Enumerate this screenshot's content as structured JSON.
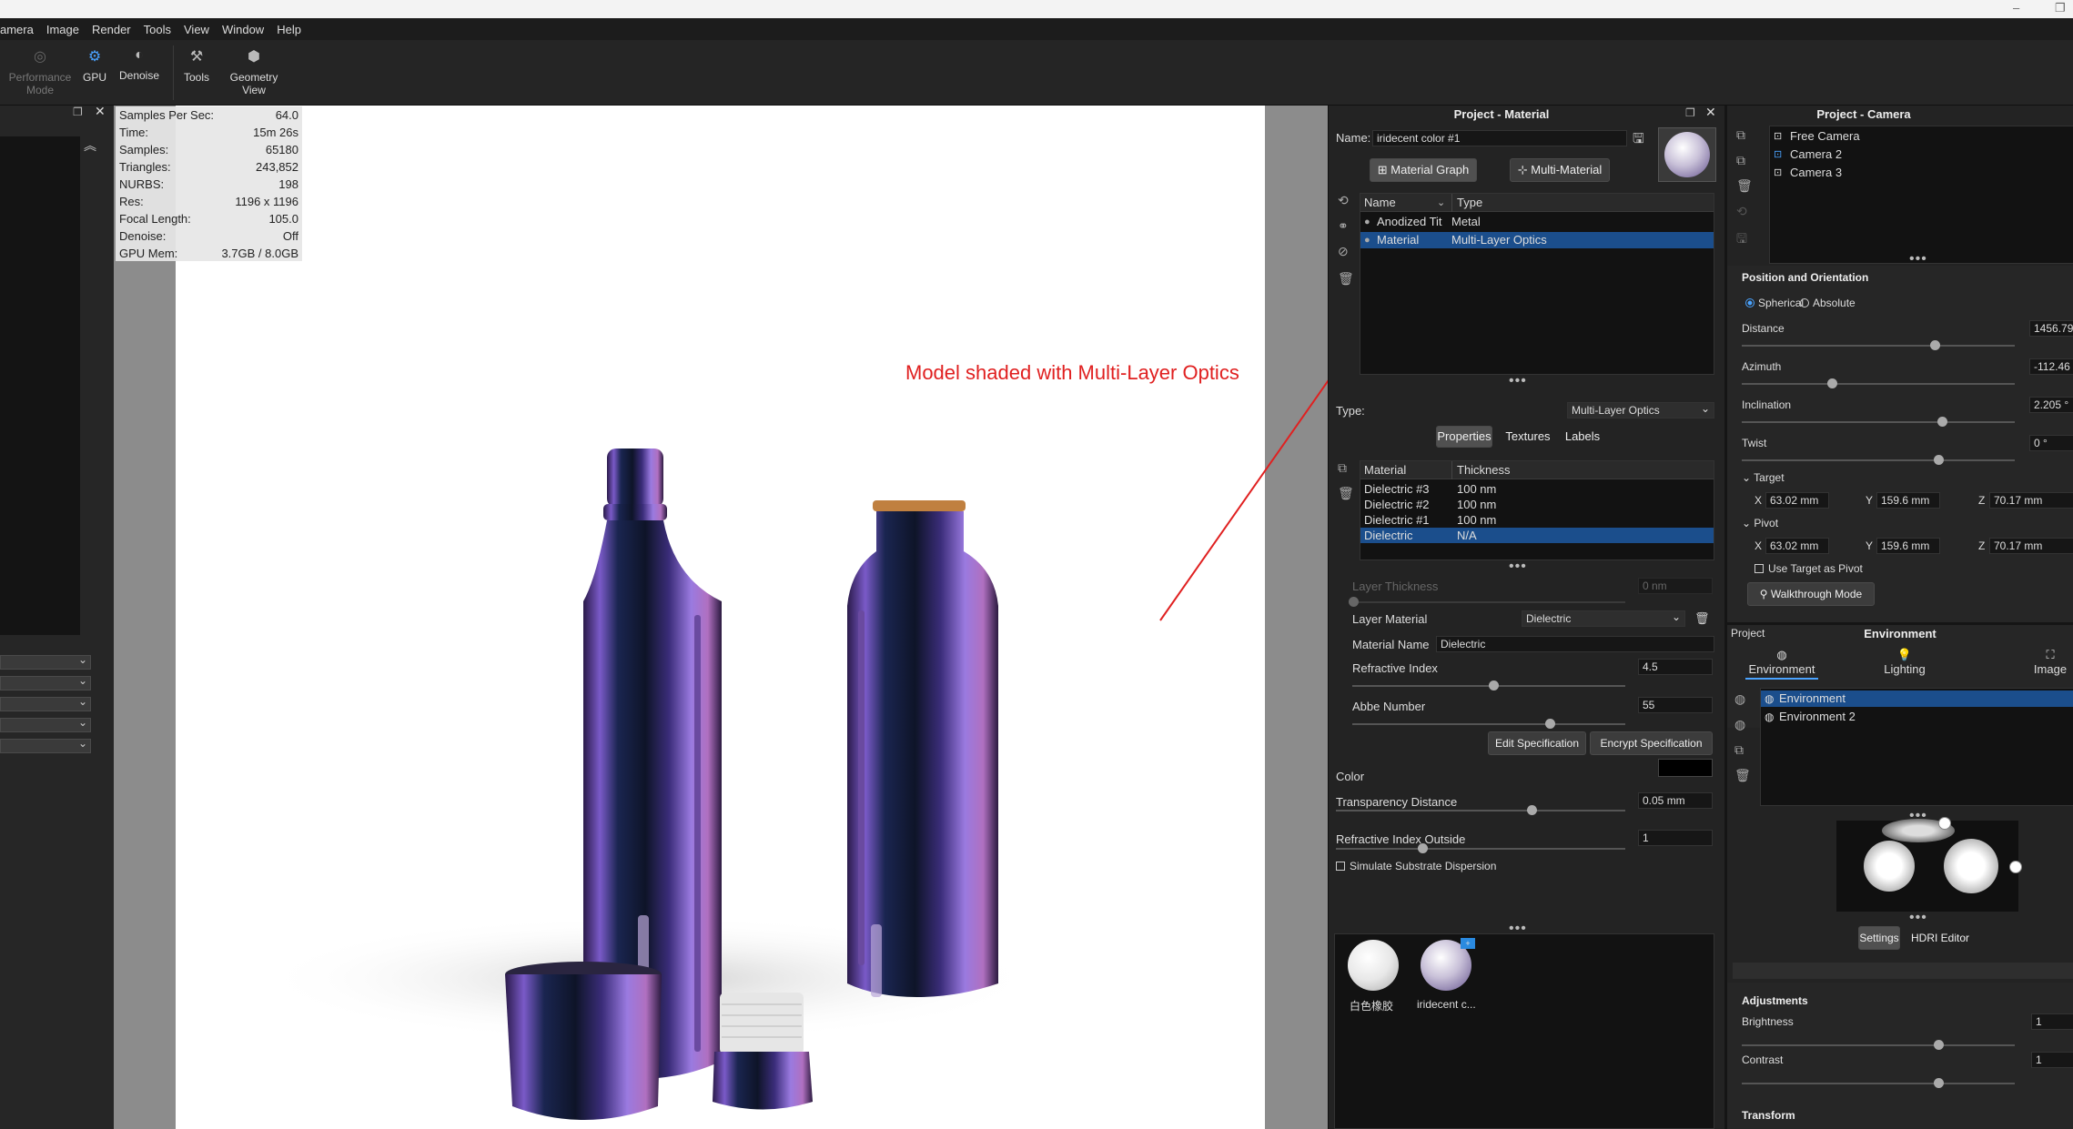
{
  "menu": [
    "amera",
    "Image",
    "Render",
    "Tools",
    "View",
    "Window",
    "Help"
  ],
  "toolbar": {
    "performance_mode": "Performance Mode",
    "gpu": "GPU",
    "denoise": "Denoise",
    "tools": "Tools",
    "geometry_view": "Geometry View"
  },
  "stats": [
    {
      "k": "Samples Per Sec:",
      "v": "64.0"
    },
    {
      "k": "Time:",
      "v": "15m 26s"
    },
    {
      "k": "Samples:",
      "v": "65180"
    },
    {
      "k": "Triangles:",
      "v": "243,852"
    },
    {
      "k": "NURBS:",
      "v": "198"
    },
    {
      "k": "Res:",
      "v": "1196 x 1196"
    },
    {
      "k": "Focal Length:",
      "v": "105.0"
    },
    {
      "k": "Denoise:",
      "v": "Off"
    },
    {
      "k": "GPU Mem:",
      "v": "3.7GB / 8.0GB"
    }
  ],
  "annotation": "Model shaded with Multi-Layer Optics",
  "material_panel": {
    "title": "Project - Material",
    "name_label": "Name:",
    "name_value": "iridecent color #1",
    "material_graph": "Material Graph",
    "multi_material": "Multi-Material",
    "list_headers": [
      "Name",
      "Type"
    ],
    "list_rows": [
      {
        "name": "Anodized Tit",
        "type": "Metal",
        "selected": false
      },
      {
        "name": "Material",
        "type": "Multi-Layer Optics",
        "selected": true
      }
    ],
    "type_label": "Type:",
    "type_value": "Multi-Layer Optics",
    "tabs": [
      "Properties",
      "Textures",
      "Labels"
    ],
    "layer_headers": [
      "Material",
      "Thickness"
    ],
    "layers": [
      {
        "name": "Dielectric #3",
        "thickness": "100 nm",
        "selected": false
      },
      {
        "name": "Dielectric #2",
        "thickness": "100 nm",
        "selected": false
      },
      {
        "name": "Dielectric #1",
        "thickness": "100 nm",
        "selected": false
      },
      {
        "name": "Dielectric",
        "thickness": "N/A",
        "selected": true
      }
    ],
    "layer_thickness_label": "Layer Thickness",
    "layer_thickness_value": "0 nm",
    "layer_material_label": "Layer Material",
    "layer_material_value": "Dielectric",
    "material_name_label": "Material Name",
    "material_name_value": "Dielectric",
    "refractive_index_label": "Refractive Index",
    "refractive_index_value": "4.5",
    "abbe_label": "Abbe Number",
    "abbe_value": "55",
    "edit_spec": "Edit Specification",
    "encrypt_spec": "Encrypt Specification",
    "color_label": "Color",
    "color_value": "#000000",
    "transparency_label": "Transparency Distance",
    "transparency_value": "0.05 mm",
    "ri_outside_label": "Refractive Index Outside",
    "ri_outside_value": "1",
    "simulate_label": "Simulate Substrate Dispersion",
    "swatches": [
      "白色橡胶",
      "iridecent c..."
    ]
  },
  "camera_panel": {
    "title": "Project - Camera",
    "cameras": [
      "Free Camera",
      "Camera 2",
      "Camera 3"
    ],
    "pos_section": "Position and Orientation",
    "spherical": "Spherical",
    "absolute": "Absolute",
    "distance_label": "Distance",
    "distance_value": "1456.79",
    "azimuth_label": "Azimuth",
    "azimuth_value": "-112.46",
    "inclination_label": "Inclination",
    "inclination_value": "2.205 °",
    "twist_label": "Twist",
    "twist_value": "0 °",
    "target_label": "Target",
    "pivot_label": "Pivot",
    "x_label": "X",
    "y_label": "Y",
    "z_label": "Z",
    "x_value": "63.02 mm",
    "y_value": "159.6 mm",
    "z_value": "70.17 mm",
    "use_target_pivot": "Use Target as Pivot",
    "walkthrough": "Walkthrough Mode"
  },
  "env_panel": {
    "project_label": "Project",
    "title": "Environment",
    "tabs": [
      "Environment",
      "Lighting",
      "Image"
    ],
    "environments": [
      {
        "name": "Environment",
        "selected": true
      },
      {
        "name": "Environment 2",
        "selected": false
      }
    ],
    "settings": "Settings",
    "hdri_editor": "HDRI Editor",
    "adjustments": "Adjustments",
    "brightness_label": "Brightness",
    "brightness_value": "1",
    "contrast_label": "Contrast",
    "contrast_value": "1",
    "transform": "Transform"
  },
  "colors": {
    "accent": "#1b4e8c",
    "annotation": "#e02020",
    "panel": "#232323"
  }
}
